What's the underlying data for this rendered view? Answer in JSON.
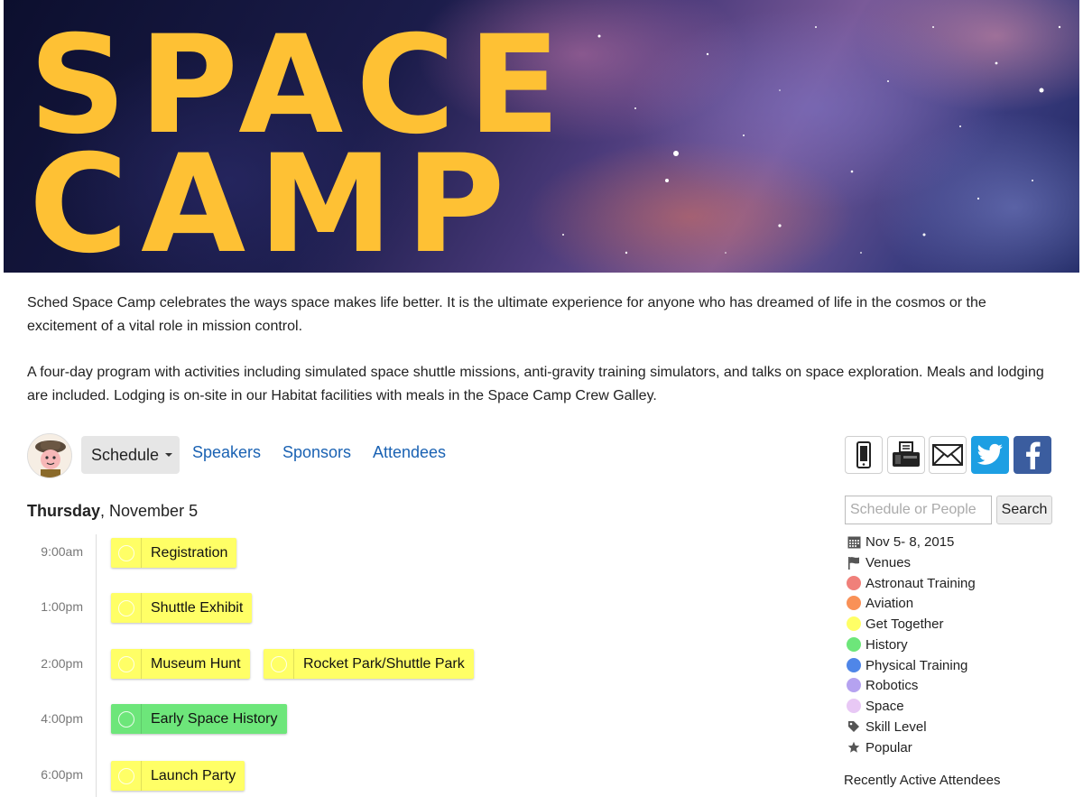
{
  "banner": {
    "logo_line1": "SPACE",
    "logo_line2": "CAMP",
    "logo_color": "#fec134"
  },
  "description": {
    "p1": "Sched Space Camp celebrates the ways space makes life better. It is the ultimate experience for anyone who has dreamed of life in the cosmos or the excitement of a vital role in mission control.",
    "p2": "A four-day program with activities including simulated space shuttle missions, anti-gravity training simulators, and talks on space exploration. Meals and lodging are included. Lodging is on-site in our Habitat facilities with meals in the Space Camp Crew Galley."
  },
  "nav": {
    "schedule": "Schedule",
    "speakers": "Speakers",
    "sponsors": "Sponsors",
    "attendees": "Attendees"
  },
  "share": {
    "icons": [
      "mobile-icon",
      "fax-icon",
      "mail-icon",
      "twitter-icon",
      "facebook-icon"
    ],
    "twitter_color": "#1d9fe3",
    "facebook_color": "#3b5d9f"
  },
  "search": {
    "placeholder": "Schedule or People",
    "button": "Search"
  },
  "sidebar": {
    "dates": "Nov 5- 8, 2015",
    "venues": "Venues",
    "categories": [
      {
        "label": "Astronaut Training",
        "color": "#f0807a"
      },
      {
        "label": "Aviation",
        "color": "#f99157"
      },
      {
        "label": "Get Together",
        "color": "#ffff66"
      },
      {
        "label": "History",
        "color": "#6de67a"
      },
      {
        "label": "Physical Training",
        "color": "#4f86e8"
      },
      {
        "label": "Robotics",
        "color": "#b5a2f0"
      },
      {
        "label": "Space",
        "color": "#e8c8f5"
      }
    ],
    "skill_level": "Skill Level",
    "popular": "Popular",
    "recent_attendees": "Recently Active Attendees"
  },
  "schedule": {
    "day": "Thursday",
    "date": ", November 5",
    "times": [
      "9:00am",
      "1:00pm",
      "2:00pm",
      "4:00pm",
      "6:00pm"
    ],
    "events": [
      {
        "label": "Registration",
        "color": "#ffff66"
      },
      {
        "label": "Shuttle Exhibit",
        "color": "#ffff66"
      },
      {
        "label": "Museum Hunt",
        "color": "#ffff66"
      },
      {
        "label": "Rocket Park/Shuttle Park",
        "color": "#ffff66"
      },
      {
        "label": "Early Space History",
        "color": "#6de67a"
      },
      {
        "label": "Launch Party",
        "color": "#ffff66"
      }
    ]
  }
}
